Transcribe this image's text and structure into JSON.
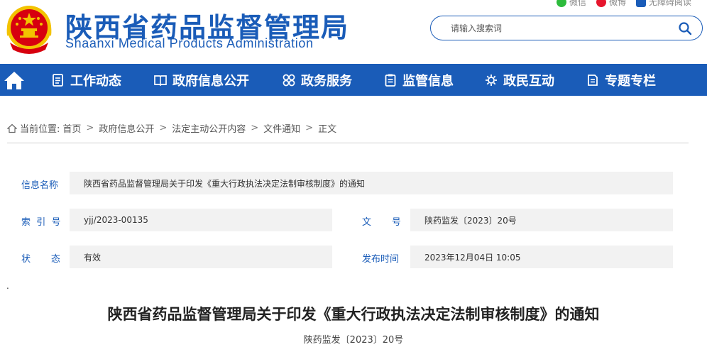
{
  "header": {
    "title": "陕西省药品监督管理局",
    "subtitle": "Shaanxi Medical Products Administration",
    "top_links": [
      {
        "label": "微信",
        "icon": "wechat-icon",
        "color": "#2dbb3c"
      },
      {
        "label": "微博",
        "icon": "weibo-icon",
        "color": "#e6162d"
      },
      {
        "label": "无障碍阅读",
        "icon": "accessibility-icon",
        "color": "#1a5cb8"
      }
    ]
  },
  "search": {
    "placeholder": "请输入搜索词"
  },
  "nav": {
    "home_icon": "home-icon",
    "items": [
      {
        "label": "工作动态",
        "icon": "document-icon"
      },
      {
        "label": "政府信息公开",
        "icon": "book-icon"
      },
      {
        "label": "政务服务",
        "icon": "grid-icon"
      },
      {
        "label": "监管信息",
        "icon": "clipboard-icon"
      },
      {
        "label": "政民互动",
        "icon": "interaction-icon"
      },
      {
        "label": "专题专栏",
        "icon": "folder-icon"
      }
    ]
  },
  "breadcrumb": {
    "prefix": "当前位置:",
    "items": [
      "首页",
      "政府信息公开",
      "法定主动公开内容",
      "文件通知",
      "正文"
    ],
    "separator": ">"
  },
  "info": {
    "name_label": "信息名称",
    "name_value": "陕西省药品监督管理局关于印发《重大行政执法决定法制审核制度》的通知",
    "index_label": "索  引  号",
    "index_value": "yjj/2023-00135",
    "doc_label": "文       号",
    "doc_value": "陕药监发〔2023〕20号",
    "status_label": "状       态",
    "status_value": "有效",
    "date_label": "发布时间",
    "date_value": "2023年12月04日 10:05"
  },
  "misc": {
    "dot": "."
  },
  "article": {
    "title": "陕西省药品监督管理局关于印发《重大行政执法决定法制审核制度》的通知",
    "doc_number": "陕药监发〔2023〕20号"
  },
  "colors": {
    "brand": "#1a5cb8",
    "label_bg": "#f2f2f2",
    "emblem_red": "#d7000f",
    "emblem_gold": "#f3c300"
  }
}
